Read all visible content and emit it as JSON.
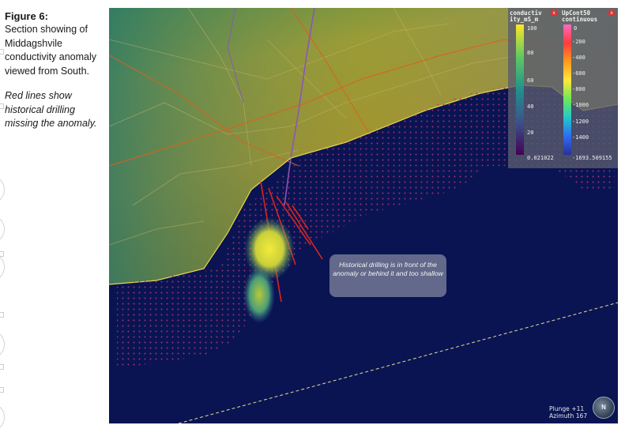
{
  "caption": {
    "title": "Figure 6:",
    "body": "Section showing of Middagshvile conductivity anomaly viewed from South.",
    "note": "Red lines show historical drilling missing the anomaly."
  },
  "figure": {
    "annotation": "Historical drilling is in front of the anomaly or behind it and too shallow",
    "orientation": {
      "plunge": "Plunge +11",
      "azimuth": "Azimuth 167"
    },
    "compass_label": "N",
    "legend": {
      "conductivity": {
        "title": "conductiv ity_mS_m",
        "ticks": [
          "100",
          "80",
          "60",
          "40",
          "20",
          "0.021022"
        ],
        "colors": [
          "#fde725",
          "#5ec962",
          "#21918c",
          "#3b528b",
          "#440154"
        ]
      },
      "upcont": {
        "title": "UpCont50 continuous",
        "ticks": [
          "0",
          "-200",
          "-400",
          "-600",
          "-800",
          "-1000",
          "-1200",
          "-1400",
          "-1693.509155"
        ],
        "colors": [
          "#ff69c0",
          "#ff3b3b",
          "#ff9a1f",
          "#ffe83a",
          "#6ee85a",
          "#22c9c9",
          "#2f6cf0",
          "#2b2f9c"
        ]
      }
    },
    "colors": {
      "background": "#0a1453",
      "drillhole": "#b0326e",
      "historical_drilling": "#d8261e",
      "anomaly_high": "#f1e43c"
    }
  }
}
